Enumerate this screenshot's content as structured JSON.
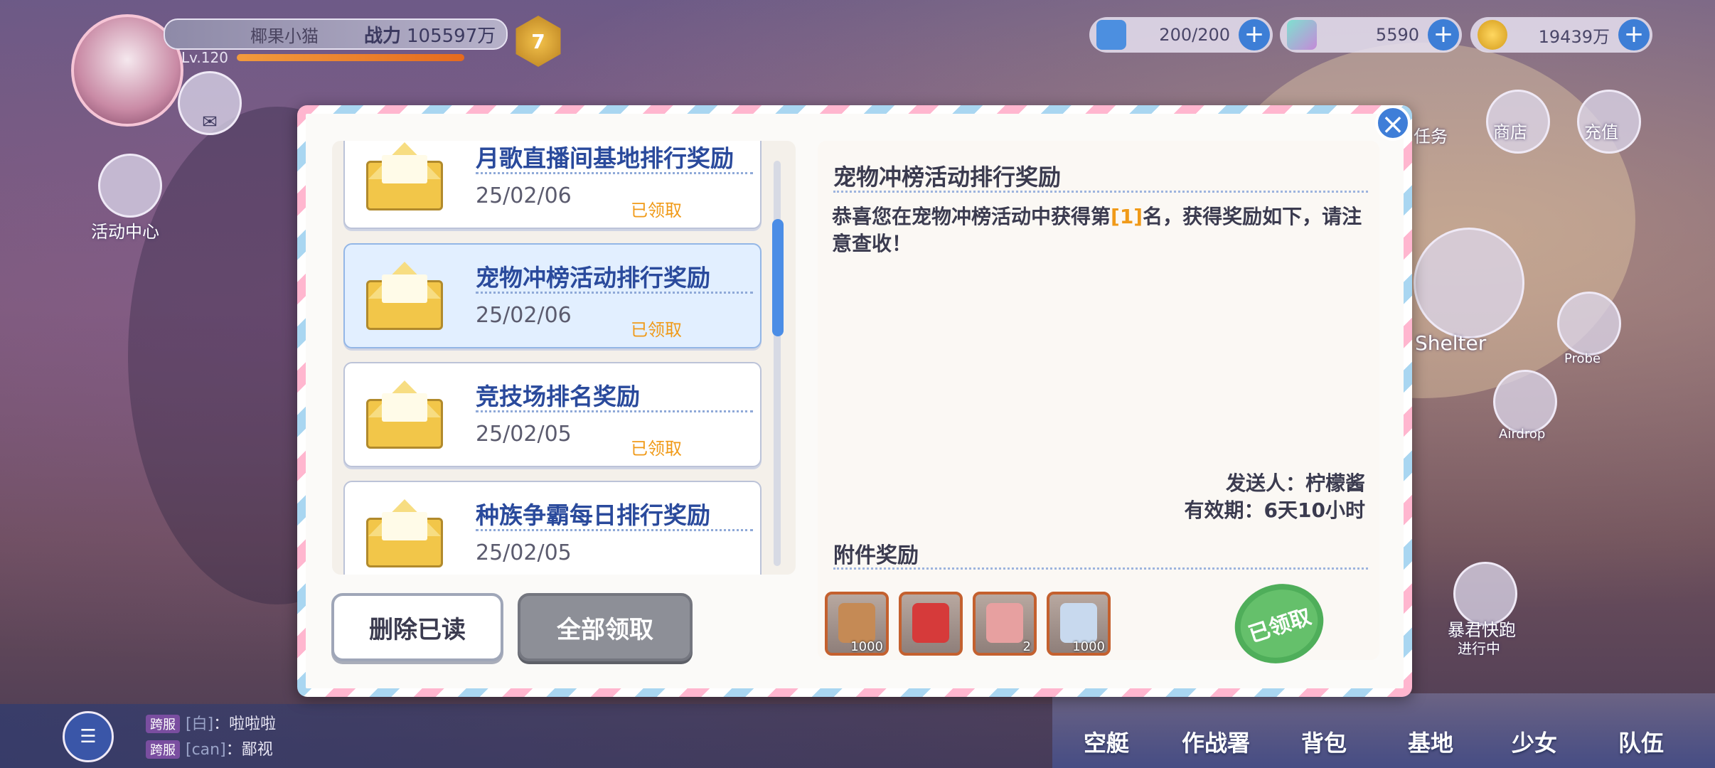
{
  "player": {
    "name": "椰果小猫",
    "power_label": "战力",
    "power_value": "105597万",
    "level": "Lv.120",
    "rank_badge": "7"
  },
  "currencies": [
    {
      "icon": "stamina-icon",
      "value": "200/200"
    },
    {
      "icon": "crystal-icon",
      "value": "5590"
    },
    {
      "icon": "coin-icon",
      "value": "19439万"
    }
  ],
  "side": {
    "activity_center": "活动中心",
    "task": "任务",
    "shop": "商店",
    "recharge": "充值",
    "shelter": "Shelter",
    "probe": "Probe",
    "airdrop": "Airdrop",
    "tyrant_run": "暴君快跑",
    "in_progress": "进行中"
  },
  "mail_list": [
    {
      "title": "月歌直播间基地排行奖励",
      "date": "25/02/06",
      "status": "已领取"
    },
    {
      "title": "宠物冲榜活动排行奖励",
      "date": "25/02/06",
      "status": "已领取"
    },
    {
      "title": "竞技场排名奖励",
      "date": "25/02/05",
      "status": "已领取"
    },
    {
      "title": "种族争霸每日排行奖励",
      "date": "25/02/05",
      "status": ""
    }
  ],
  "buttons": {
    "delete_read": "删除已读",
    "claim_all": "全部领取",
    "close": "×"
  },
  "detail": {
    "title": "宠物冲榜活动排行奖励",
    "body_pre": "恭喜您在宠物冲榜活动中获得第",
    "rank": "[1]",
    "body_post": "名，获得奖励如下，请注意查收！",
    "sender": "发送人：柠檬酱",
    "expire": "有效期：6天10小时",
    "attach_title": "附件奖励",
    "claimed_stamp": "已领取"
  },
  "attachments": [
    {
      "icon": "crate-icon",
      "qty": "1000",
      "color": "#c58a55"
    },
    {
      "icon": "red-box-icon",
      "qty": "",
      "color": "#d63a3a"
    },
    {
      "icon": "pet-card-icon",
      "qty": "2",
      "color": "#e7a0a0"
    },
    {
      "icon": "food-bag-icon",
      "qty": "1000",
      "color": "#c8d9ee"
    }
  ],
  "chat": [
    {
      "tag": "跨服",
      "name": "[白]",
      "text": "：啦啦啦"
    },
    {
      "tag": "跨服",
      "name": "[can]",
      "text": "：鄙视"
    }
  ],
  "nav": [
    "空艇",
    "作战署",
    "背包",
    "基地",
    "少女",
    "队伍"
  ]
}
